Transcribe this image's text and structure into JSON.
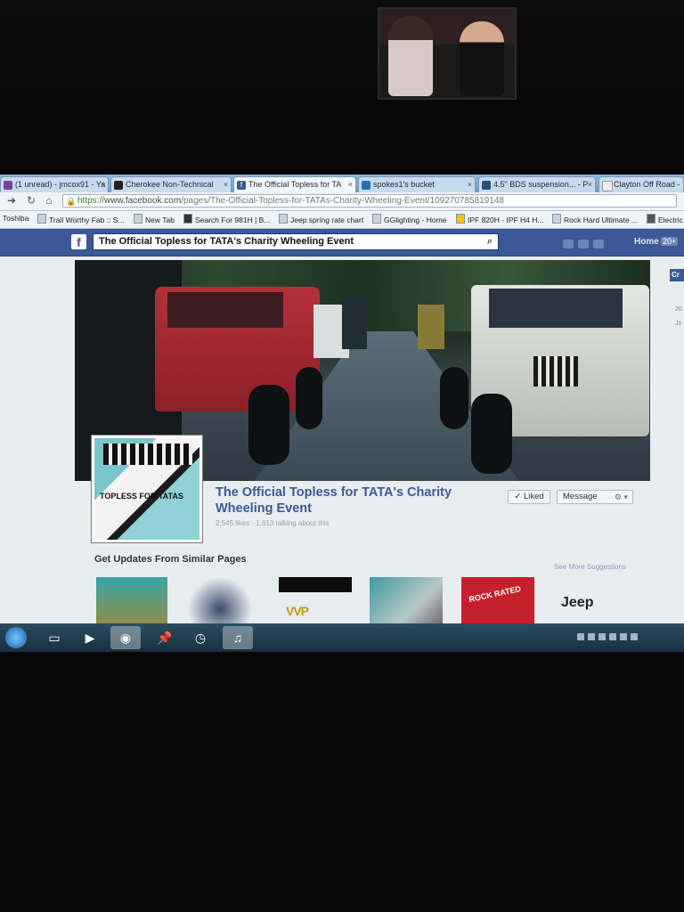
{
  "tabs": [
    {
      "label": "(1 unread) - jmcox91 - Ya",
      "icon": "yahoo-icon"
    },
    {
      "label": "Cherokee Non-Technical",
      "icon": "jeep-forum-icon"
    },
    {
      "label": "The Official Topless for TA",
      "icon": "facebook-icon"
    },
    {
      "label": "spokes1's bucket",
      "icon": "photobucket-icon"
    },
    {
      "label": "4.5\" BDS suspension... - P",
      "icon": "vbulletin-icon"
    },
    {
      "label": "Clayton Off Road - ",
      "icon": "page-icon"
    }
  ],
  "address": {
    "secure": "https://",
    "host": "www.facebook.com",
    "path": "/pages/The-Official-Topless-for-TATAs-Charity-Wheeling-Event/109270785819148"
  },
  "bookmarks": [
    "Toshiba",
    "Trail Worthy Fab :: S...",
    "New Tab",
    "Search For 981H | B...",
    "Jeep spring rate chart",
    "GGlighting - Home",
    "IPF 820H - IPF H4 H...",
    "Rock Hard Ultimate ...",
    "Electric"
  ],
  "facebook": {
    "logo": "f",
    "search_value": "The Official Topless for TATA's Charity Wheeling Event",
    "home_label": "Home",
    "home_badge": "20+",
    "page_name": "The Official Topless for TATA's Charity Wheeling Event",
    "stats": "2,545 likes · 1,613 talking about this",
    "liked_label": "Liked",
    "message_label": "Message",
    "create_peek": "Cr",
    "side_numbers": [
      "20",
      "Jo"
    ],
    "updates_title": "Get Updates From Similar Pages",
    "see_more": "See More Suggestions",
    "suggestions": [
      {
        "name": "suggestion-1"
      },
      {
        "name": "suggestion-2"
      },
      {
        "name": "suggestion-3",
        "text": "VVP"
      },
      {
        "name": "suggestion-4"
      },
      {
        "name": "suggestion-5",
        "text": "ROCK RATED"
      },
      {
        "name": "suggestion-6",
        "text": "Jeep"
      }
    ],
    "profile_text": "TOPLESS FOR TATAS"
  },
  "taskbar": {
    "items": [
      "explorer-icon",
      "media-player-icon",
      "chrome-icon",
      "pin-icon",
      "clock-app-icon",
      "itunes-icon"
    ]
  },
  "colors": {
    "facebook_blue": "#3b5998",
    "taskbar": "#1f3c4e"
  }
}
